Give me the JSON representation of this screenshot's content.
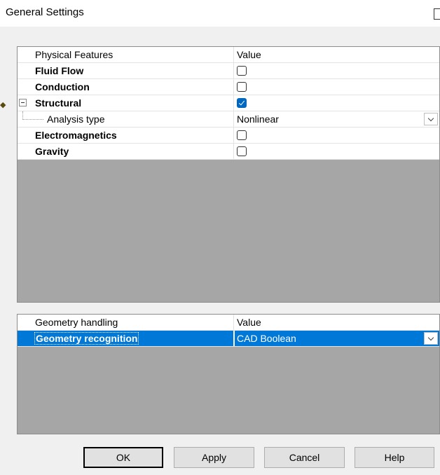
{
  "window": {
    "title": "General Settings"
  },
  "physics_table": {
    "header": {
      "name": "Physical Features",
      "value": "Value"
    },
    "rows": [
      {
        "label": "Fluid Flow",
        "checked": false
      },
      {
        "label": "Conduction",
        "checked": false
      },
      {
        "label": "Structural",
        "checked": true,
        "expanded": true
      },
      {
        "label": "Analysis type",
        "value": "Nonlinear"
      },
      {
        "label": "Electromagnetics",
        "checked": false
      },
      {
        "label": "Gravity",
        "checked": false
      }
    ]
  },
  "geometry_table": {
    "header": {
      "name": "Geometry handling",
      "value": "Value"
    },
    "rows": [
      {
        "label": "Geometry recognition",
        "value": "CAD Boolean",
        "selected": true
      }
    ]
  },
  "buttons": {
    "ok": "OK",
    "apply": "Apply",
    "cancel": "Cancel",
    "help": "Help"
  },
  "colors": {
    "selection": "#0078d7",
    "checkbox_checked": "#0067c0",
    "panel_background": "#a6a6a6",
    "dialog_background": "#f0f0f0"
  }
}
